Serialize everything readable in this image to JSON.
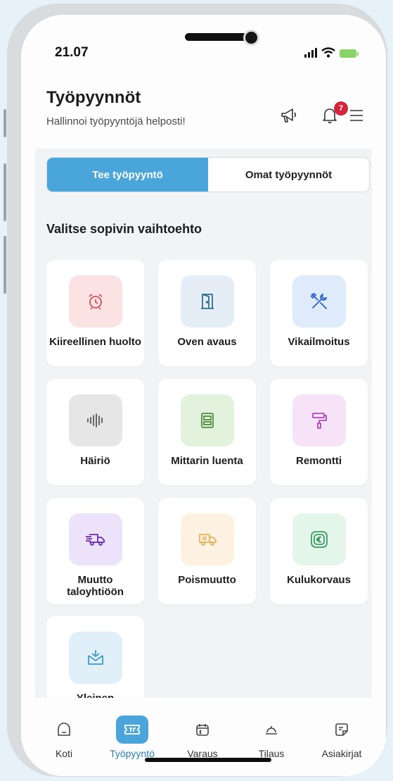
{
  "status": {
    "time": "21.07"
  },
  "header": {
    "title": "Työpyynnöt",
    "subtitle": "Hallinnoi työpyyntöjä helposti!",
    "notification_count": "7"
  },
  "tabs": [
    {
      "label": "Tee työpyyntö",
      "active": true
    },
    {
      "label": "Omat työpyynnöt",
      "active": false
    }
  ],
  "section_title": "Valitse sopivin vaihtoehto",
  "options": [
    {
      "label": "Kiireellinen huolto",
      "icon": "alarm-clock-icon",
      "bg": "#fbe3e3",
      "color": "#d6515a"
    },
    {
      "label": "Oven avaus",
      "icon": "door-icon",
      "bg": "#e5eef7",
      "color": "#2f6f93"
    },
    {
      "label": "Vikailmoitus",
      "icon": "tools-icon",
      "bg": "#dfeafb",
      "color": "#2c62c9"
    },
    {
      "label": "Häiriö",
      "icon": "sound-wave-icon",
      "bg": "#e6e6e6",
      "color": "#555555"
    },
    {
      "label": "Mittarin luenta",
      "icon": "meter-icon",
      "bg": "#e3f2dc",
      "color": "#4c8c3a"
    },
    {
      "label": "Remontti",
      "icon": "paint-roller-icon",
      "bg": "#f6e3f8",
      "color": "#b245c0"
    },
    {
      "label": "Muutto taloyhtiöön",
      "icon": "moving-truck-icon",
      "bg": "#ece3fa",
      "color": "#6a2ab8"
    },
    {
      "label": "Poismuutto",
      "icon": "moving-truck-out-icon",
      "bg": "#fdf1e2",
      "color": "#e5b35a"
    },
    {
      "label": "Kulukorvaus",
      "icon": "euro-icon",
      "bg": "#e4f6ea",
      "color": "#3b9a62"
    },
    {
      "label": "Yleinen",
      "icon": "inbox-icon",
      "bg": "#e1f0f8",
      "color": "#3a9cc8"
    }
  ],
  "nav": [
    {
      "label": "Koti",
      "icon": "home-icon",
      "active": false
    },
    {
      "label": "Työpyyntö",
      "icon": "ticket-icon",
      "active": true
    },
    {
      "label": "Varaus",
      "icon": "calendar-icon",
      "active": false
    },
    {
      "label": "Tilaus",
      "icon": "service-bell-icon",
      "active": false
    },
    {
      "label": "Asiakirjat",
      "icon": "document-icon",
      "active": false
    }
  ]
}
